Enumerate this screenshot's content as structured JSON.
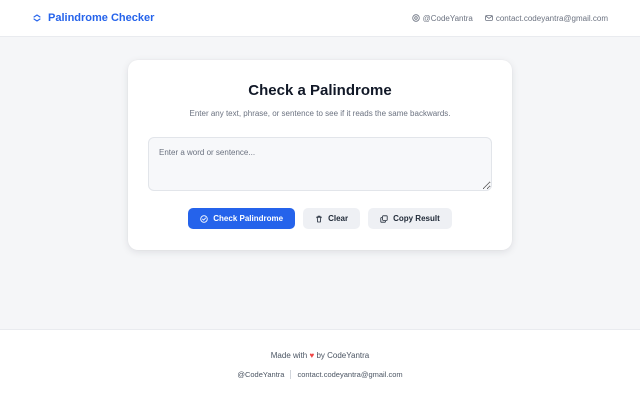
{
  "header": {
    "brand_title": "Palindrome Checker",
    "links": {
      "handle": "@CodeYantra",
      "email": "contact.codeyantra@gmail.com"
    }
  },
  "card": {
    "title": "Check a Palindrome",
    "subtitle": "Enter any text, phrase, or sentence to see if it reads the same backwards.",
    "input": {
      "placeholder": "Enter a word or sentence...",
      "value": ""
    },
    "buttons": {
      "check_label": "Check Palindrome",
      "clear_label": "Clear",
      "copy_label": "Copy Result"
    }
  },
  "footer": {
    "made_with_prefix": "Made with",
    "heart": "♥",
    "made_with_suffix": "by CodeYantra",
    "handle": "@CodeYantra",
    "email": "contact.codeyantra@gmail.com"
  },
  "colors": {
    "accent": "#2563eb",
    "heart": "#ef4444",
    "page_background": "#f5f6f8"
  },
  "icons": {
    "brand": "swap-arrows-icon",
    "handle": "at-icon",
    "email": "mail-icon",
    "check": "check-circle-icon",
    "clear": "trash-icon",
    "copy": "copy-icon"
  }
}
